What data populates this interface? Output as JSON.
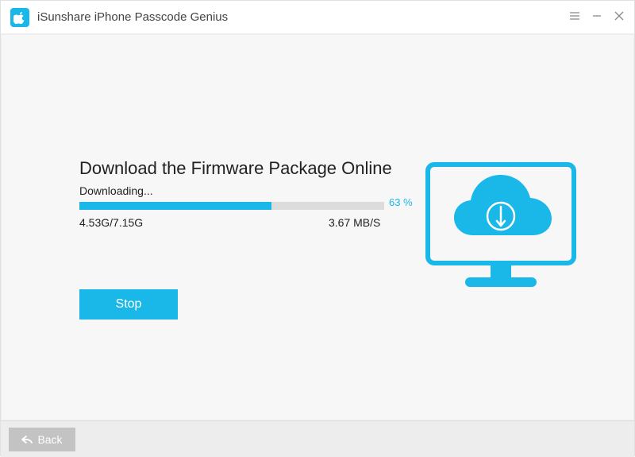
{
  "app_title": "iSunshare iPhone Passcode Genius",
  "main": {
    "heading": "Download the Firmware Package Online",
    "status": "Downloading...",
    "progress_pct_text": "63 %",
    "progress_pct": 63,
    "size_ratio": "4.53G/7.15G",
    "speed": "3.67 MB/S",
    "stop_label": "Stop"
  },
  "footer": {
    "back_label": "Back"
  },
  "colors": {
    "accent": "#1ab8e8",
    "bg_panel": "#f7f7f7"
  }
}
